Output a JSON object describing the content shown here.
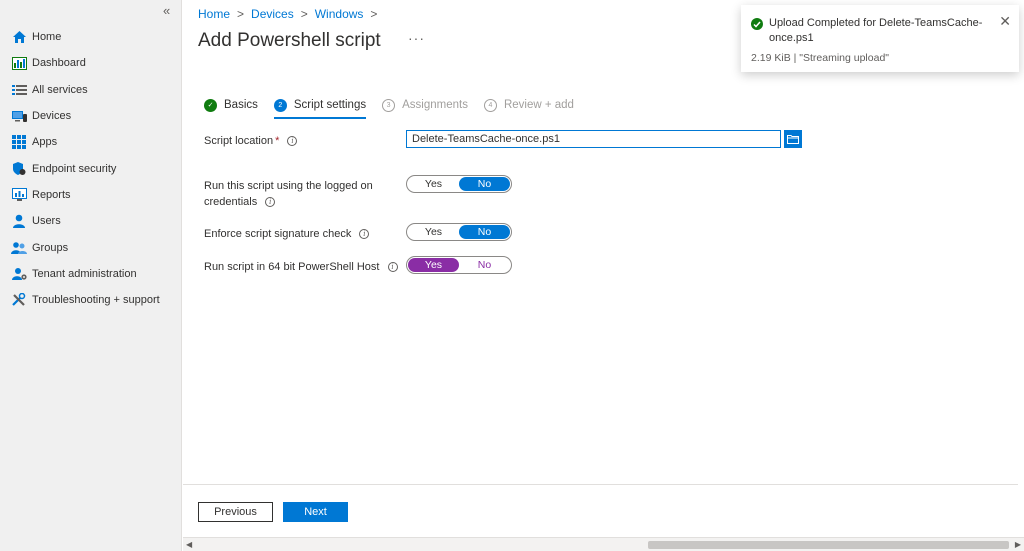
{
  "sidebar": {
    "collapse_glyph": "«",
    "items": [
      {
        "label": "Home",
        "icon": "home-icon"
      },
      {
        "label": "Dashboard",
        "icon": "dashboard-icon"
      },
      {
        "label": "All services",
        "icon": "list-icon"
      },
      {
        "label": "Devices",
        "icon": "devices-icon"
      },
      {
        "label": "Apps",
        "icon": "apps-icon"
      },
      {
        "label": "Endpoint security",
        "icon": "shield-icon"
      },
      {
        "label": "Reports",
        "icon": "reports-icon"
      },
      {
        "label": "Users",
        "icon": "user-icon"
      },
      {
        "label": "Groups",
        "icon": "groups-icon"
      },
      {
        "label": "Tenant administration",
        "icon": "tenant-icon"
      },
      {
        "label": "Troubleshooting + support",
        "icon": "wrench-icon"
      }
    ]
  },
  "breadcrumb": {
    "items": [
      "Home",
      "Devices",
      "Windows"
    ],
    "sep": ">"
  },
  "page": {
    "title": "Add Powershell script",
    "more": "···"
  },
  "tabs": [
    {
      "label": "Basics",
      "badge": "✓",
      "state": "done"
    },
    {
      "label": "Script settings",
      "badge": "2",
      "state": "active"
    },
    {
      "label": "Assignments",
      "badge": "3",
      "state": "inactive"
    },
    {
      "label": "Review + add",
      "badge": "4",
      "state": "inactive"
    }
  ],
  "form": {
    "script_location_label": "Script location",
    "required_mark": "*",
    "info_glyph": "i",
    "script_location_value": "Delete-TeamsCache-once.ps1",
    "run_logged_on_label_1": "Run this script using the logged on",
    "run_logged_on_label_2": "credentials",
    "enforce_signature_label": "Enforce script signature check",
    "run_64bit_label": "Run script in 64 bit PowerShell Host",
    "yes": "Yes",
    "no": "No"
  },
  "footer": {
    "previous": "Previous",
    "next": "Next"
  },
  "toast": {
    "title": "Upload Completed for Delete-TeamsCache-once.ps1",
    "subtitle": "2.19 KiB | \"Streaming upload\"",
    "close": "✕"
  },
  "colors": {
    "accent": "#0078d4",
    "success": "#107c10",
    "purple": "#8a2da5"
  }
}
